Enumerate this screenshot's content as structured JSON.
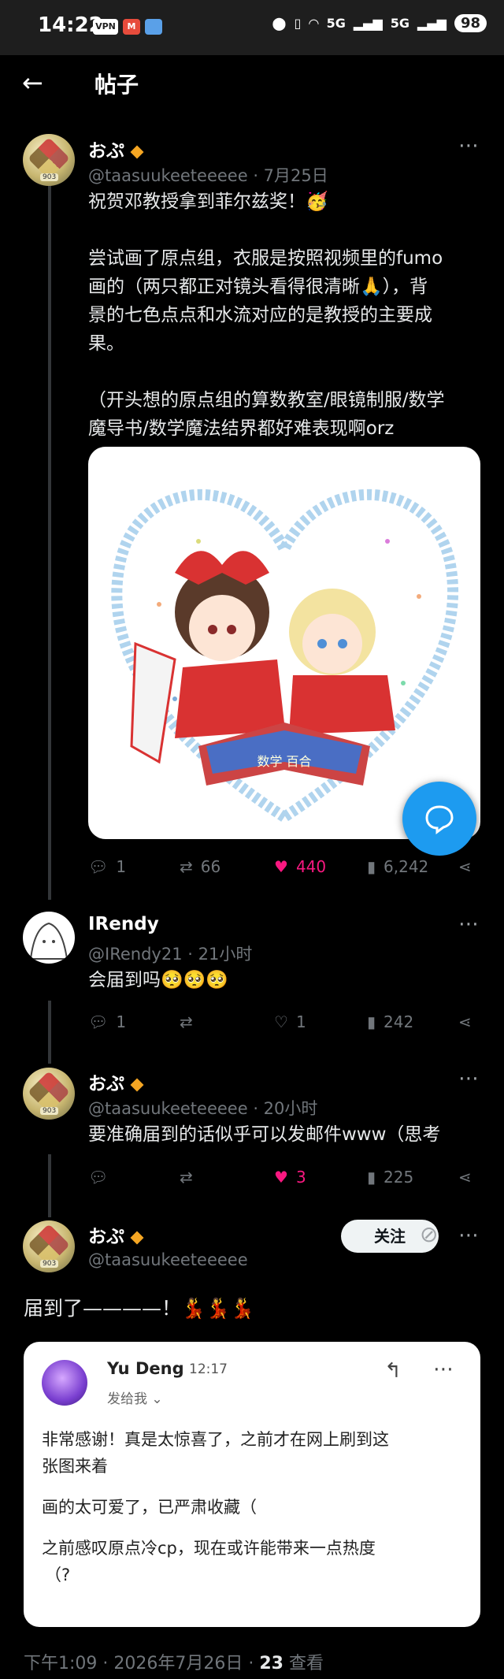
{
  "status_bar": {
    "time": "14:22",
    "vpn": "VPN",
    "net1": "5G",
    "net2": "5G",
    "battery": "98"
  },
  "header": {
    "title": "帖子"
  },
  "tweets": [
    {
      "name": "おぷ",
      "handle": "@taasuukeeteeeee",
      "date": "· 7月25日",
      "line1": "祝贺邓教授拿到菲尔兹奖！🥳",
      "p2a": "尝试画了原点组，衣服是按照视频里的fumo",
      "p2b": "画的（两只都正对镜头看得很清晰🙏），背",
      "p2c": "景的七色点点和水流对应的是教授的主要成",
      "p2d": "果。",
      "p3a": "（开头想的原点组的算数教室/眼镜制服/数学",
      "p3b": "魔导书/数学魔法结界都好难表现啊orz",
      "image_text": "数学 百合",
      "replies": "1",
      "retweets": "66",
      "likes": "440",
      "views": "6,242"
    },
    {
      "name": "IRendy",
      "handle": "@IRendy21",
      "date": "· 21小时",
      "text": "会届到吗🥺🥺🥺",
      "replies": "1",
      "retweets": "",
      "likes": "1",
      "views": "242"
    },
    {
      "name": "おぷ",
      "handle": "@taasuukeeteeeee",
      "date": "· 20小时",
      "text": "要准确届到的话似乎可以发邮件www（思考",
      "replies": "",
      "retweets": "",
      "likes": "3",
      "views": "225"
    }
  ],
  "main": {
    "name": "おぷ",
    "handle": "@taasuukeeteeeee",
    "follow_label": "关注",
    "text": "届到了————！💃💃💃",
    "footer_time": "下午1:09 · 2026年7月26日 · ",
    "footer_views": "23",
    "footer_views_label": " 查看"
  },
  "email": {
    "sender": "Yu Deng",
    "time": "12:17",
    "to": "发给我 ⌄",
    "l1": "非常感谢！真是太惊喜了，之前才在网上刷到这",
    "l2": "张图来着",
    "l3": "画的太可爱了，已严肃收藏（",
    "l4": "之前感叹原点冷cp，现在或许能带来一点热度",
    "l5": "（?"
  },
  "colors": {
    "like": "#f91880",
    "accent": "#1d9bf0",
    "badge": "#f5a623"
  }
}
